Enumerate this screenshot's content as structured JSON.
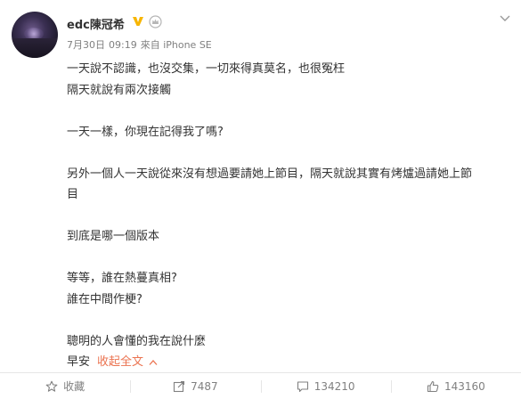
{
  "author": {
    "name": "edc陳冠希",
    "verified_icon": "verified-v-icon",
    "level_icon": "member-crown-icon",
    "accent": "#f7b500"
  },
  "meta": {
    "date": "7月30日",
    "time": "09:19",
    "source": "來自 iPhone SE"
  },
  "content": {
    "lines": [
      "一天說不認識，也沒交集，一切來得真莫名，也很冤枉",
      "隔天就說有兩次接觸",
      "",
      "一天一樣，你現在記得我了嗎?",
      "",
      "另外一個人一天說從來沒有想過要請她上節目，隔天就說其實有烤爐過請她上節",
      "目",
      "",
      "到底是哪一個版本",
      "",
      "等等，誰在熱蔓真相?",
      "誰在中間作梗?",
      "",
      "聰明的人會懂的我在說什麼"
    ],
    "last_line": "早安",
    "collapse_label": "收起全文",
    "link_color": "#eb7350"
  },
  "actions": {
    "favorite": "收藏",
    "repost": "7487",
    "comment": "134210",
    "like": "143160"
  }
}
